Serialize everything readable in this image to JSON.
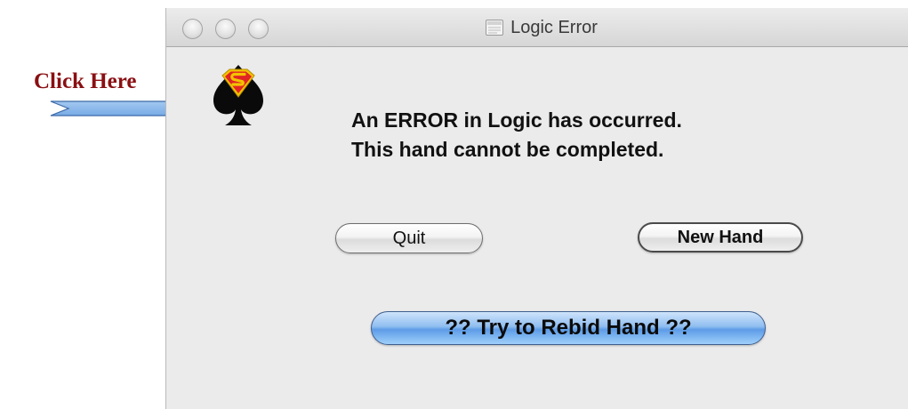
{
  "annotation": {
    "label": "Click Here",
    "color": "#8a0f12"
  },
  "window": {
    "title": "Logic Error",
    "title_icon": "document-icon",
    "traffic_lights": [
      "close",
      "minimize",
      "zoom"
    ]
  },
  "app_icon": {
    "name": "superman-spade-icon"
  },
  "message": {
    "line1": "An ERROR in Logic has occurred.",
    "line2": "This hand cannot be completed."
  },
  "buttons": {
    "quit": "Quit",
    "new_hand": "New Hand",
    "rebid": "?? Try to Rebid Hand ??"
  },
  "colors": {
    "rebid_button": "#5d9ce6",
    "window_background": "#ebebeb"
  }
}
